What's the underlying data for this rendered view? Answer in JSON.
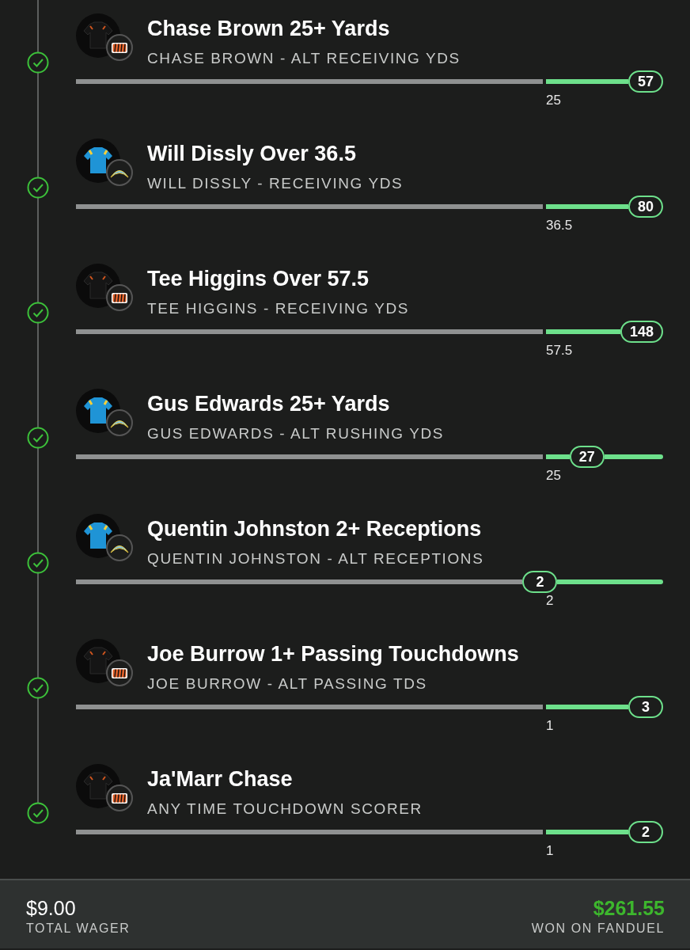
{
  "legs": [
    {
      "title": "Chase Brown 25+ Yards",
      "subtitle": "CHASE BROWN - ALT RECEIVING YDS",
      "kind": "bengals",
      "won": true,
      "threshold": "25",
      "value": "57",
      "level": 1
    },
    {
      "title": "Will Dissly Over 36.5",
      "subtitle": "WILL DISSLY - RECEIVING YDS",
      "kind": "chargers",
      "won": true,
      "threshold": "36.5",
      "value": "80",
      "level": 1
    },
    {
      "title": "Tee Higgins Over 57.5",
      "subtitle": "TEE HIGGINS - RECEIVING YDS",
      "kind": "bengals",
      "won": true,
      "threshold": "57.5",
      "value": "148",
      "level": 1
    },
    {
      "title": "Gus Edwards 25+ Yards",
      "subtitle": "GUS EDWARDS - ALT RUSHING YDS",
      "kind": "chargers",
      "won": true,
      "threshold": "25",
      "value": "27",
      "level": 0.9
    },
    {
      "title": "Quentin Johnston 2+ Receptions",
      "subtitle": "QUENTIN JOHNSTON - ALT RECEPTIONS",
      "kind": "chargers",
      "won": true,
      "threshold": "2",
      "value": "2",
      "level": 0.82
    },
    {
      "title": "Joe Burrow 1+ Passing Touchdowns",
      "subtitle": "JOE BURROW - ALT PASSING TDS",
      "kind": "bengals",
      "won": true,
      "threshold": "1",
      "value": "3",
      "level": 1
    },
    {
      "title": "Ja'Marr Chase",
      "subtitle": "ANY TIME TOUCHDOWN SCORER",
      "kind": "bengals",
      "won": true,
      "threshold": "1",
      "value": "2",
      "level": 1
    }
  ],
  "footer": {
    "wager": "$9.00",
    "wager_label": "TOTAL WAGER",
    "payout": "$261.55",
    "payout_label": "WON ON FANDUEL"
  }
}
